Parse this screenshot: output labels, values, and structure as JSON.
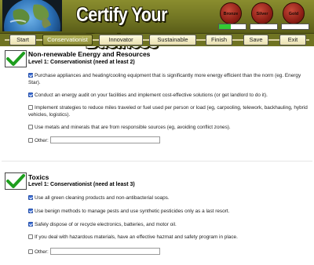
{
  "header": {
    "title": "Certify Your Business",
    "medals": {
      "bronze": "Bronze",
      "silver": "Silver",
      "gold": "Gold"
    },
    "progress": {
      "bronze": 0.45,
      "silver": 0,
      "gold": 0
    },
    "colors": {
      "header_bg": "#6f7322",
      "progress_fill": "#33cc33",
      "medal": "#8e1f16"
    }
  },
  "nav": {
    "tabs": [
      {
        "label": "Start",
        "active": false
      },
      {
        "label": "Conservationist",
        "active": true
      },
      {
        "label": "Innovator",
        "active": false
      },
      {
        "label": "Sustainable",
        "active": false
      },
      {
        "label": "Finish",
        "active": false
      },
      {
        "label": "Save",
        "active": false
      },
      {
        "label": "Exit",
        "active": false
      }
    ]
  },
  "sections": [
    {
      "title": "Non-renewable Energy and Resources",
      "subtitle": "Level 1: Conservationist (need at least 2)",
      "icon": "green-checkmark-icon",
      "items": [
        {
          "label": "Purchase appliances and heating/cooling equipment that is significantly more energy efficient than the norm (eg. Energy Star).",
          "checked": true
        },
        {
          "label": "Conduct an energy audit on your facilities and implement cost-effective solutions (or get landlord to do it).",
          "checked": true
        },
        {
          "label": "Implement strategies to reduce miles traveled or fuel used per person or load (eg, carpooling, telework, backhauling, hybrid vehicles, logistics).",
          "checked": false
        },
        {
          "label": "Use metals and minerals that are from responsible sources (eg, avoiding conflict zones).",
          "checked": false
        }
      ],
      "other_label": "Other:",
      "other_value": ""
    },
    {
      "title": "Toxics",
      "subtitle": "Level 1: Conservationist (need at least 3)",
      "icon": "green-checkmark-icon",
      "items": [
        {
          "label": "Use all green cleaning products and non-antibacterial soaps.",
          "checked": true
        },
        {
          "label": "Use benign methods to manage pests and use synthetic pesticides only as a last resort.",
          "checked": true
        },
        {
          "label": "Safely dispose of or recycle electronics, batteries, and motor oil.",
          "checked": true
        },
        {
          "label": "If you deal with hazardous materials, have an effective hazmat and safety program in place.",
          "checked": false
        }
      ],
      "other_label": "Other:",
      "other_value": ""
    }
  ]
}
